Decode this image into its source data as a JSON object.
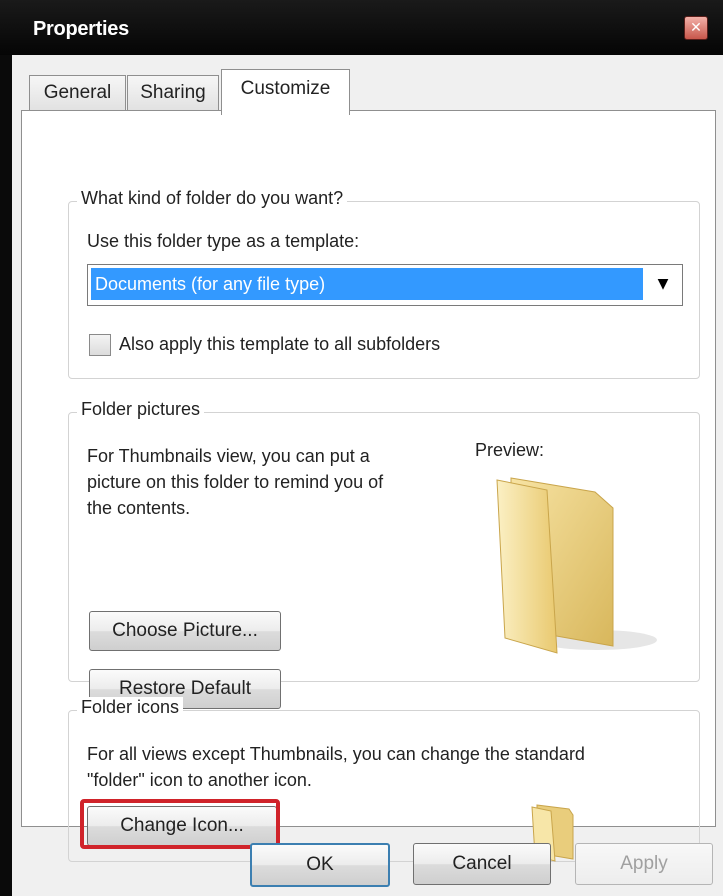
{
  "window": {
    "title": "Properties",
    "close_glyph": "✕"
  },
  "tabs": [
    {
      "label": "General",
      "selected": false
    },
    {
      "label": "Sharing",
      "selected": false
    },
    {
      "label": "Customize",
      "selected": true
    }
  ],
  "folder_type": {
    "group_title": "What kind of folder do you want?",
    "template_label": "Use this folder type as a template:",
    "template_value": "Documents (for any file type)",
    "dropdown_icon": "chevron-down-icon",
    "apply_subfolders_label": "Also apply this template to all subfolders",
    "apply_subfolders_checked": false
  },
  "folder_pictures": {
    "group_title": "Folder pictures",
    "description_lines": [
      "For Thumbnails view, you can put a",
      "picture on this folder to remind you of",
      "the contents."
    ],
    "preview_label": "Preview:",
    "choose_picture_label": "Choose Picture...",
    "restore_default_label": "Restore Default"
  },
  "folder_icons": {
    "group_title": "Folder icons",
    "description_lines": [
      "For all views except Thumbnails, you can change the standard",
      "\"folder\" icon to another icon."
    ],
    "change_icon_label": "Change Icon...",
    "highlight_color": "#d0232a"
  },
  "footer": {
    "ok_label": "OK",
    "cancel_label": "Cancel",
    "apply_label": "Apply"
  },
  "colors": {
    "selection": "#3399ff",
    "folder": "#f2d27a",
    "title_bar": "#0a0a0a"
  }
}
